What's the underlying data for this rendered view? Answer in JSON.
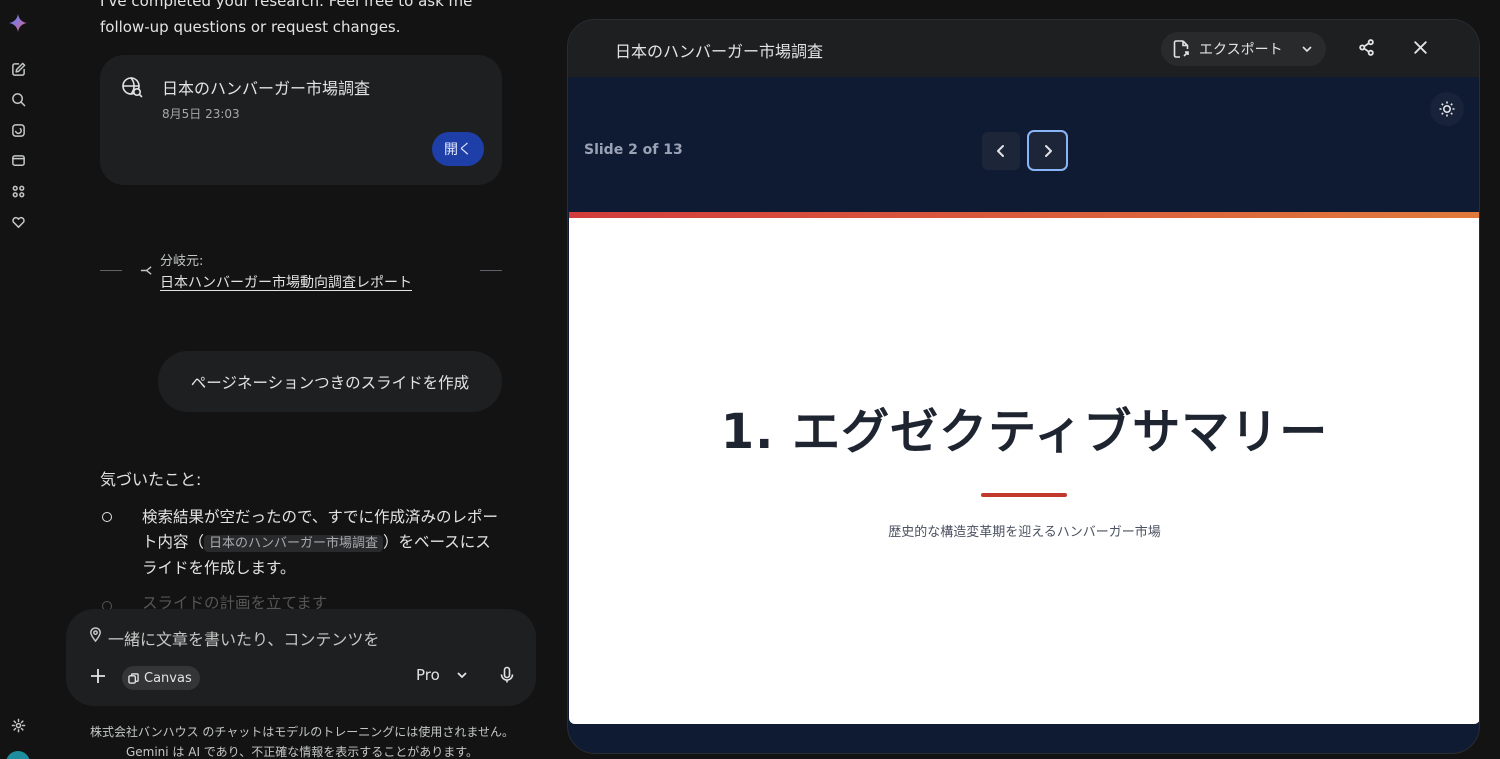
{
  "colors": {
    "accent_button": "#1f3fa8",
    "panel_bg": "#0f1b33",
    "slide_bar": "#d23c3c",
    "focus_ring": "#8ab4f8"
  },
  "rail": {
    "icons": [
      "gemini-logo-icon",
      "new-chat-icon",
      "search-icon",
      "gem-icon",
      "library-icon",
      "apps-icon",
      "heart-icon",
      "settings-icon"
    ]
  },
  "chat": {
    "intro_text": "I've completed your research. Feel free to ask me follow-up questions or request changes.",
    "card": {
      "title": "日本のハンバーガー市場調査",
      "date": "8月5日 23:03",
      "open_label": "開く"
    },
    "branch": {
      "label": "分岐元:",
      "link": "日本ハンバーガー市場動向調査レポート"
    },
    "user_message": "ページネーションつきのスライドを作成",
    "notice_heading": "気づいたこと:",
    "bullet1": {
      "before": "検索結果が空だったので、すでに作成済みのレポート内容（",
      "chip": "日本のハンバーガー市場調査",
      "after": "）をベースにスライドを作成します。"
    },
    "bullet2": "スライドの計画を立てます"
  },
  "input": {
    "placeholder": "一緒に文章を書いたり、コンテンツを",
    "canvas_chip": "Canvas",
    "model": "Pro"
  },
  "disclaimer": {
    "line1": "株式会社バンハウス のチャットはモデルのトレーニングには使用されません。",
    "line2": "Gemini は AI であり、不正確な情報を表示することがあります。"
  },
  "panel": {
    "title": "日本のハンバーガー市場調査",
    "export_label": "エクスポート",
    "slide_counter": "Slide 2 of 13",
    "slide": {
      "title": "1. エグゼクティブサマリー",
      "subtitle": "歴史的な構造変革期を迎えるハンバーガー市場"
    }
  }
}
